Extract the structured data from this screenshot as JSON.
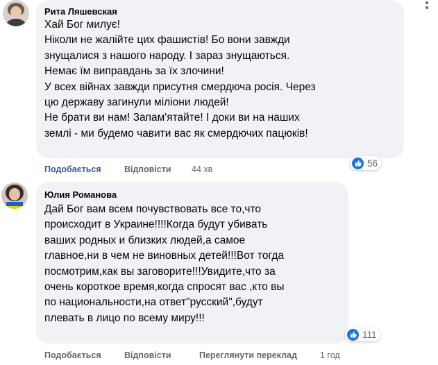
{
  "comments": [
    {
      "author": "Рита Ляшевская",
      "text": "Хай Бог милує!\nНіколи не жалійте цих фашистів! Бо вони завжди\nзнущалися з нашого народу. І зараз знущаються.\nНемає їм виправдань за їх злочини!\nУ всех війнах завжди присутня смердюча росія. Через\nцю державу загинули міліони людей!\nНе брати ви нам! Запам'ятайте! І доки ви на наших\nземлі - ми будемо чавити вас як смердючих пацюків!",
      "actions": {
        "like": "Подобається",
        "reply": "Відповісти",
        "time": "44 хв"
      },
      "reactions": {
        "icon": "thumbs-up-icon",
        "count": "56"
      }
    },
    {
      "author": "Юлия Романова",
      "text": "Дай Бог вам всем почувствовать все то,что\nпроисходит в Украине!!!!Когда будут убивать\nваших родных и близких людей,а самое\nглавное,ни в чем не виновных детей!!!Вот тогда\nпосмотрим,как вы заговорите!!!Увидите,что за\nочень короткое время,когда спросят вас ,кто вы\nпо национальности,на ответ\"русский\",будут\nплевать в лицо по всему миру!!!",
      "actions": {
        "like": "Подобається",
        "reply": "Відповісти",
        "translate": "Переглянути переклад",
        "time": "1 год"
      },
      "reactions": {
        "icon": "thumbs-up-icon",
        "count": "111"
      }
    }
  ],
  "colors": {
    "bubble": "#f0f2f5",
    "like_blue": "#1b74e4",
    "action_gray": "#65676b",
    "liked_text": "#385898"
  }
}
